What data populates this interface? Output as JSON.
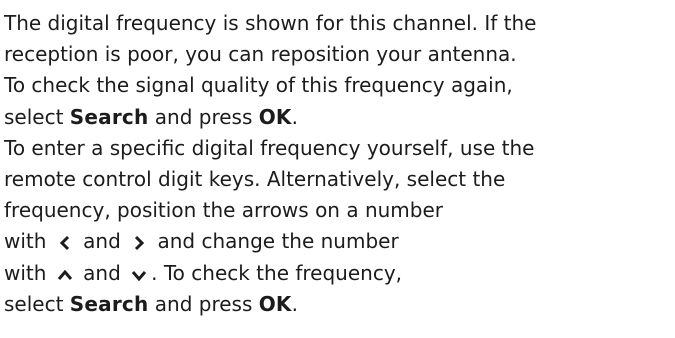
{
  "help": {
    "l1": "The digital frequency is shown for this channel. If the",
    "l2": "reception is poor, you can reposition your antenna.",
    "l3": "To check the signal quality of this frequency again,",
    "l4a": "select ",
    "l4b": "Search",
    "l4c": " and press ",
    "l4d": "OK",
    "l4e": ".",
    "l5": "To enter a specific digital frequency yourself, use the",
    "l6": "remote control digit keys. Alternatively, select the",
    "l7": "frequency, position the arrows on a number",
    "l8a": "with ",
    "l8b": " and ",
    "l8c": " and change the number",
    "l9a": "with ",
    "l9b": " and ",
    "l9c": ". To check the frequency,",
    "l10a": "select ",
    "l10b": "Search",
    "l10c": " and press ",
    "l10d": "OK",
    "l10e": "."
  },
  "icons": {
    "left": "chevron-left-icon",
    "right": "chevron-right-icon",
    "up": "chevron-up-icon",
    "down": "chevron-down-icon"
  }
}
